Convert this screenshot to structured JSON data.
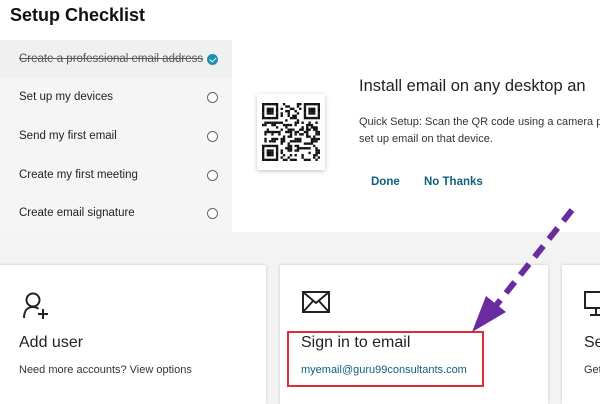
{
  "header": {
    "title": "Setup Checklist"
  },
  "checklist": {
    "items": [
      {
        "label": "Create a professional email address",
        "done": true
      },
      {
        "label": "Set up my devices",
        "done": false
      },
      {
        "label": "Send my first email",
        "done": false
      },
      {
        "label": "Create my first meeting",
        "done": false
      },
      {
        "label": "Create email signature",
        "done": false
      }
    ]
  },
  "panel": {
    "title": "Install email on any desktop an",
    "desc_line1": "Quick Setup: Scan the QR code using a camera p",
    "desc_line2": "set up email on that device.",
    "done_label": "Done",
    "no_thanks_label": "No Thanks"
  },
  "cards": {
    "add_user": {
      "icon": "add-user-icon",
      "title": "Add user",
      "subtitle": "Need more accounts? View options"
    },
    "sign_in": {
      "icon": "envelope-icon",
      "title": "Sign in to email",
      "email": "myemail@guru99consultants.com"
    },
    "third": {
      "icon": "monitor-icon",
      "title": "Se",
      "subtitle": "Get"
    }
  },
  "colors": {
    "accent": "#10607a",
    "check": "#1f8fb0",
    "highlight": "#e02b3a",
    "arrow": "#6a2aa0"
  }
}
